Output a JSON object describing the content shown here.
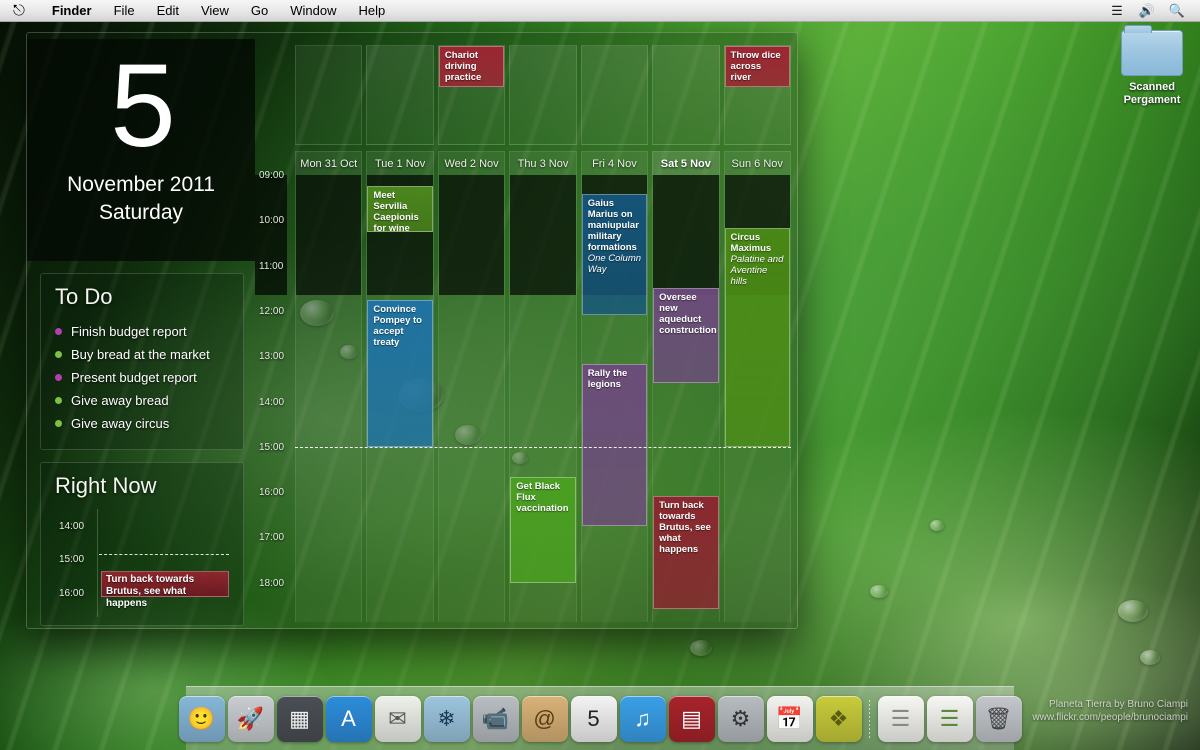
{
  "menubar": {
    "apple_glyph": "⎋",
    "items": [
      {
        "label": "Finder",
        "bold": true
      },
      {
        "label": "File",
        "bold": false
      },
      {
        "label": "Edit",
        "bold": false
      },
      {
        "label": "View",
        "bold": false
      },
      {
        "label": "Go",
        "bold": false
      },
      {
        "label": "Window",
        "bold": false
      },
      {
        "label": "Help",
        "bold": false
      }
    ],
    "right_icons": [
      {
        "name": "spaces-icon",
        "glyph": "☰"
      },
      {
        "name": "volume-icon",
        "glyph": "🔊"
      },
      {
        "name": "search-icon",
        "glyph": "🔍"
      }
    ]
  },
  "desktop_icon": {
    "name": "folder-icon",
    "label_line1": "Scanned",
    "label_line2": "Pergament"
  },
  "sidebar": {
    "day_number": "5",
    "month_year": "November 2011",
    "weekday": "Saturday",
    "todo": {
      "title": "To Do",
      "items": [
        {
          "label": "Finish budget report",
          "color": "#b43fb0"
        },
        {
          "label": "Buy bread at the market",
          "color": "#7dc243"
        },
        {
          "label": "Present budget report",
          "color": "#b43fb0"
        },
        {
          "label": "Give away bread",
          "color": "#7dc243"
        },
        {
          "label": "Give away circus",
          "color": "#7dc243"
        }
      ]
    },
    "rightnow": {
      "title": "Right Now",
      "times": [
        "14:00",
        "15:00",
        "16:00"
      ],
      "now_time": "15:00",
      "event": "Turn back towards Brutus, see what happens",
      "event_color": "#8e2430"
    }
  },
  "calendar": {
    "time_labels": [
      "09:00",
      "10:00",
      "11:00",
      "12:00",
      "13:00",
      "14:00",
      "15:00",
      "16:00",
      "17:00",
      "18:00"
    ],
    "now_time": "15:00",
    "days": [
      {
        "header": "Mon 31 Oct",
        "today": false
      },
      {
        "header": "Tue 1 Nov",
        "today": false
      },
      {
        "header": "Wed 2 Nov",
        "today": false
      },
      {
        "header": "Thu 3 Nov",
        "today": false
      },
      {
        "header": "Fri 4 Nov",
        "today": false
      },
      {
        "header": "Sat 5 Nov",
        "today": true
      },
      {
        "header": "Sun 6 Nov",
        "today": false
      }
    ],
    "allday_events": [
      {
        "day": 2,
        "title": "Chariot driving practice",
        "color": "#9b2632"
      },
      {
        "day": 6,
        "title": "Throw dice across river",
        "color": "#9b2632"
      }
    ],
    "events": [
      {
        "day": 1,
        "title": "Meet Servilia Caepionis for wine and…",
        "location": "",
        "start": "09:15",
        "end": "10:15",
        "color": "#4f8c1e"
      },
      {
        "day": 1,
        "title": "Convince Pompey to accept treaty",
        "location": "",
        "start": "11:45",
        "end": "15:00",
        "color": "#1e72a8"
      },
      {
        "day": 3,
        "title": "Get Black Flux vaccination",
        "location": "",
        "start": "15:40",
        "end": "18:00",
        "color": "#4aa021"
      },
      {
        "day": 4,
        "title": "Gaius Marius on maniupular military formations",
        "location": "One Column Way",
        "start": "09:25",
        "end": "12:05",
        "color": "#15567e"
      },
      {
        "day": 4,
        "title": "Rally the legions",
        "location": "",
        "start": "13:10",
        "end": "16:45",
        "color": "#6d4a7d"
      },
      {
        "day": 5,
        "title": "Oversee new aqueduct construction",
        "location": "",
        "start": "11:30",
        "end": "13:35",
        "color": "#6d4a7d"
      },
      {
        "day": 5,
        "title": "Turn back towards Brutus, see what happens",
        "location": "",
        "start": "16:05",
        "end": "18:35",
        "color": "#8e2430"
      },
      {
        "day": 6,
        "title": "Circus Maximus",
        "location": "Palatine and Aventine hills",
        "start": "10:10",
        "end": "15:00",
        "color": "#4b8d16"
      }
    ]
  },
  "dock": {
    "items": [
      {
        "name": "finder-icon",
        "label": "Finder",
        "glyph": "🙂",
        "bg": "#86b7d8",
        "fg": "#123"
      },
      {
        "name": "launchpad-icon",
        "label": "Launchpad",
        "glyph": "🚀",
        "bg": "#c9cdd1",
        "fg": "#333"
      },
      {
        "name": "mission-control-icon",
        "label": "Mission Control",
        "glyph": "▦",
        "bg": "#4a4f55",
        "fg": "#eee"
      },
      {
        "name": "app-store-icon",
        "label": "App Store",
        "glyph": "A",
        "bg": "#2d8ddb",
        "fg": "#fff"
      },
      {
        "name": "mail-icon",
        "label": "Mail",
        "glyph": "✉",
        "bg": "#eef0ea",
        "fg": "#555"
      },
      {
        "name": "safari-icon",
        "label": "Safari",
        "glyph": "❄",
        "bg": "#9cc5de",
        "fg": "#1a3a55"
      },
      {
        "name": "facetime-icon",
        "label": "FaceTime",
        "glyph": "📹",
        "bg": "#b9bec3",
        "fg": "#1c3550"
      },
      {
        "name": "contacts-icon",
        "label": "Contacts",
        "glyph": "@",
        "bg": "#d9b277",
        "fg": "#5a3d14"
      },
      {
        "name": "calendar-icon",
        "label": "Calendar",
        "glyph": "5",
        "bg": "#f3f3f3",
        "fg": "#222"
      },
      {
        "name": "itunes-icon",
        "label": "iTunes",
        "glyph": "♫",
        "bg": "#3aa0e8",
        "fg": "#fff"
      },
      {
        "name": "photo-booth-icon",
        "label": "Photo Booth",
        "glyph": "▤",
        "bg": "#a8232b",
        "fg": "#fff"
      },
      {
        "name": "system-preferences-icon",
        "label": "System Preferences",
        "glyph": "⚙",
        "bg": "#b7bcc1",
        "fg": "#333"
      },
      {
        "name": "ical-document-icon",
        "label": "Calendar document",
        "glyph": "📅",
        "bg": "#f2f2ee",
        "fg": "#a33"
      },
      {
        "name": "lamp-icon",
        "label": "Lamp",
        "glyph": "❖",
        "bg": "#c8cc3a",
        "fg": "#5a5c10"
      },
      {
        "name": "document-one-icon",
        "label": "Document",
        "glyph": "☰",
        "bg": "#f6f6f2",
        "fg": "#888"
      },
      {
        "name": "document-two-icon",
        "label": "Document",
        "glyph": "☰",
        "bg": "#f6f6f2",
        "fg": "#5a8a3a"
      },
      {
        "name": "trash-icon",
        "label": "Trash",
        "glyph": "🗑",
        "bg": "#c3c7cb",
        "fg": "#444"
      }
    ],
    "separator_after_index": 13
  },
  "credit": {
    "line1": "Planeta Tierra by Bruno Ciampi",
    "line2": "www.flickr.com/people/brunociampi"
  }
}
